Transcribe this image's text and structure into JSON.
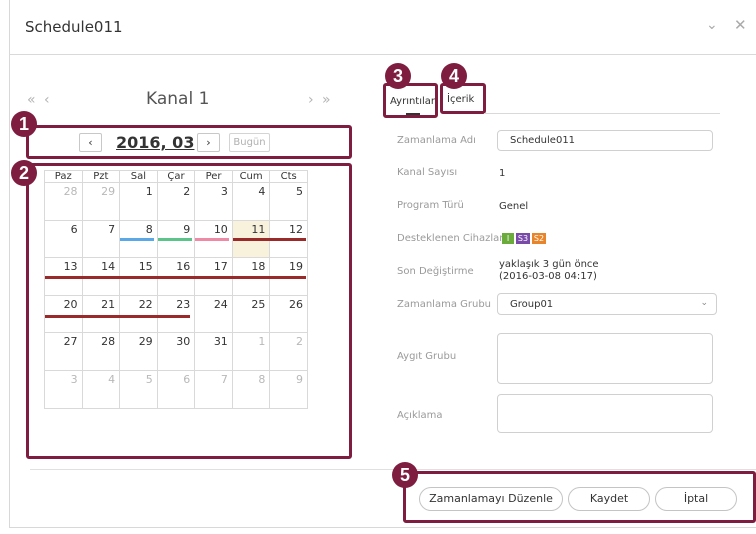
{
  "window": {
    "title": "Schedule011",
    "minimize_icon": "chevron-down-icon",
    "close_icon": "close-icon"
  },
  "calendar": {
    "nav_prev": "« ‹",
    "nav_next": "› »",
    "channel_title": "Kanal 1",
    "prev_month": "‹",
    "next_month": "›",
    "month_label": "2016, 03",
    "today_button": "Bugün",
    "weekdays": [
      "Paz",
      "Pzt",
      "Sal",
      "Çar",
      "Per",
      "Cum",
      "Cts"
    ],
    "weeks": [
      [
        "28",
        "29",
        "1",
        "2",
        "3",
        "4",
        "5"
      ],
      [
        "6",
        "7",
        "8",
        "9",
        "10",
        "11",
        "12"
      ],
      [
        "13",
        "14",
        "15",
        "16",
        "17",
        "18",
        "19"
      ],
      [
        "20",
        "21",
        "22",
        "23",
        "24",
        "25",
        "26"
      ],
      [
        "27",
        "28",
        "29",
        "30",
        "31",
        "1",
        "2"
      ],
      [
        "3",
        "4",
        "5",
        "6",
        "7",
        "8",
        "9"
      ]
    ],
    "today": "11"
  },
  "markers": [
    "1",
    "2",
    "3",
    "4",
    "5"
  ],
  "tabs": {
    "details": "Ayrıntılar",
    "content": "İçerik"
  },
  "details": {
    "schedule_name_label": "Zamanlama Adı",
    "schedule_name_value": "Schedule011",
    "channel_count_label": "Kanal Sayısı",
    "channel_count_value": "1",
    "program_type_label": "Program Türü",
    "program_type_value": "Genel",
    "supported_devices_label": "Desteklenen Cihazlar",
    "device_badges": [
      {
        "label": "I",
        "color": "#6aab3c"
      },
      {
        "label": "S3",
        "color": "#7a4aa8"
      },
      {
        "label": "S2",
        "color": "#e8852a"
      }
    ],
    "last_modified_label": "Son Değiştirme",
    "last_modified_line1": "yaklaşık 3 gün önce",
    "last_modified_line2": "(2016-03-08 04:17)",
    "schedule_group_label": "Zamanlama Grubu",
    "schedule_group_value": "Group01",
    "device_group_label": "Aygıt Grubu",
    "description_label": "Açıklama"
  },
  "footer": {
    "edit_button": "Zamanlamayı Düzenle",
    "save_button": "Kaydet",
    "cancel_button": "İptal"
  },
  "colors": {
    "accent": "#7e1d3f",
    "event_blue": "#5aa9e6",
    "event_green": "#5cc48a",
    "event_pink": "#ef8aa6",
    "event_dark_red": "#9a2a2a"
  }
}
